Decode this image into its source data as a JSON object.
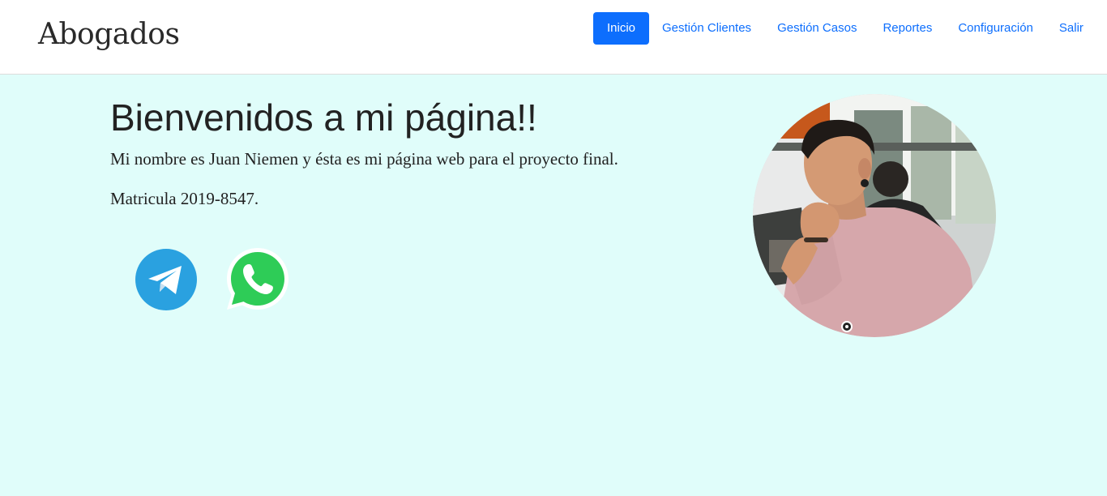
{
  "navbar": {
    "brand": "Abogados",
    "links": [
      {
        "label": "Inicio",
        "active": true
      },
      {
        "label": "Gestión Clientes",
        "active": false
      },
      {
        "label": "Gestión Casos",
        "active": false
      },
      {
        "label": "Reportes",
        "active": false
      },
      {
        "label": "Configuración",
        "active": false
      },
      {
        "label": "Salir",
        "active": false
      }
    ]
  },
  "hero": {
    "title": "Bienvenidos a mi página!!",
    "intro": "Mi nombre es Juan Niemen y ésta es mi página web para el proyecto final.",
    "matricula": "Matricula 2019-8547."
  },
  "social": [
    {
      "icon": "telegram-icon",
      "color": "#2aa1e0"
    },
    {
      "icon": "whatsapp-icon",
      "color": "#2ecc57"
    }
  ],
  "colors": {
    "page_background": "#e0fdfa",
    "navbar_background": "#ffffff",
    "accent": "#0d6efd"
  }
}
